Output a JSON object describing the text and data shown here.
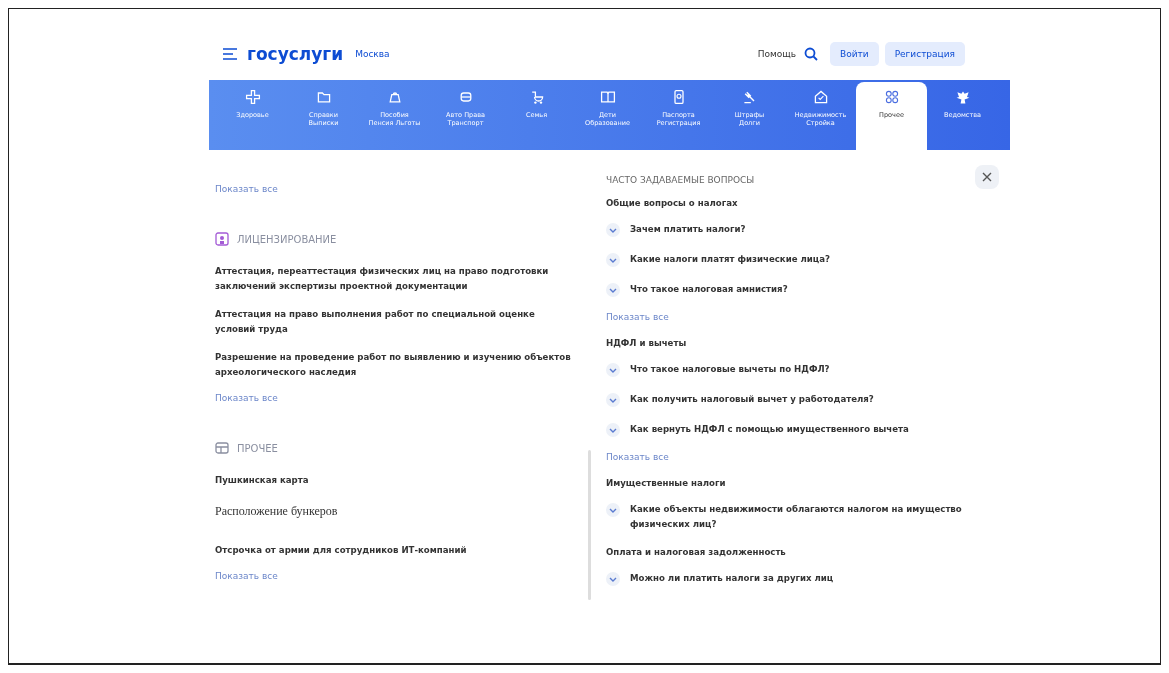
{
  "header": {
    "logo": "госуслуги",
    "city": "Москва",
    "help": "Помощь",
    "login": "Войти",
    "register": "Регистрация"
  },
  "nav": [
    {
      "lines": [
        "Здоровье"
      ],
      "selected": false
    },
    {
      "lines": [
        "Справки",
        "Выписки"
      ],
      "selected": false
    },
    {
      "lines": [
        "Пособия",
        "Пенсия Льготы"
      ],
      "selected": false
    },
    {
      "lines": [
        "Авто Права",
        "Транспорт"
      ],
      "selected": false
    },
    {
      "lines": [
        "Семья"
      ],
      "selected": false
    },
    {
      "lines": [
        "Дети",
        "Образование"
      ],
      "selected": false
    },
    {
      "lines": [
        "Паспорта",
        "Регистрация"
      ],
      "selected": false
    },
    {
      "lines": [
        "Штрафы",
        "Долги"
      ],
      "selected": false
    },
    {
      "lines": [
        "Недвижимость",
        "Стройка"
      ],
      "selected": false
    },
    {
      "lines": [
        "Прочее"
      ],
      "selected": true
    },
    {
      "lines": [
        "Ведомства"
      ],
      "selected": false
    }
  ],
  "catalog": [
    {
      "show_all": "Показать все"
    },
    {
      "title": "ЛИЦЕНЗИРОВАНИЕ",
      "items": [
        {
          "text": "Аттестация, переаттестация физических лиц на право подготовки заключений экспертизы проектной документации",
          "kind": "plain"
        },
        {
          "text": "Аттестация на право выполнения работ по специальной оценке условий труда",
          "kind": "plain"
        },
        {
          "text": "Разрешение на проведение работ по выявлению и изучению объектов археологического наследия",
          "kind": "plain"
        }
      ],
      "show_all": "Показать все"
    },
    {
      "title": "ПРОЧЕЕ",
      "items": [
        {
          "text": "Пушкинская карта",
          "kind": "plain"
        },
        {
          "text": "Расположение бункеров",
          "kind": "serif"
        },
        {
          "text": "Отсрочка от армии для сотрудников ИТ-компаний",
          "kind": "plain"
        }
      ],
      "show_all": "Показать все"
    }
  ],
  "faq": {
    "title": "ЧАСТО ЗАДАВАЕМЫЕ ВОПРОСЫ",
    "groups": [
      {
        "title": "Общие вопросы о налогах",
        "questions": [
          {
            "text": "Зачем платить налоги?",
            "expanded": false
          },
          {
            "text": "Какие налоги платят физические лица?",
            "expanded": false
          },
          {
            "text": "Что такое налоговая амнистия?",
            "expanded": false
          }
        ],
        "show_all": "Показать все"
      },
      {
        "title": "НДФЛ и вычеты",
        "questions": [
          {
            "text": "Что такое налоговые вычеты по НДФЛ?",
            "expanded": false
          },
          {
            "text": "Как получить налоговый вычет у работодателя?",
            "expanded": false
          },
          {
            "text": "Как вернуть НДФЛ с помощью имущественного вычета",
            "expanded": false
          }
        ],
        "show_all": "Показать все"
      },
      {
        "title": "Имущественные налоги",
        "questions": [
          {
            "text": "Какие объекты недвижимости облагаются налогом на имущество физических лиц?",
            "expanded": false
          }
        ]
      },
      {
        "title": "Оплата и налоговая задолженность",
        "questions": [
          {
            "text": "Можно ли платить налоги за других лиц",
            "expanded": false
          }
        ]
      }
    ]
  }
}
